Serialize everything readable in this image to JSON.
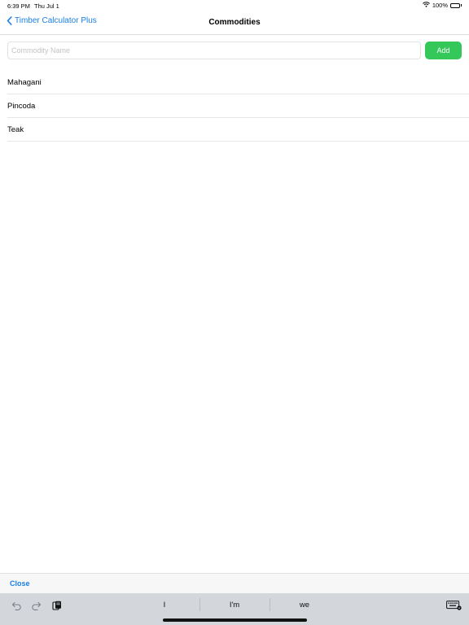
{
  "status_bar": {
    "time": "6:39 PM",
    "date": "Thu Jul 1",
    "battery": "100%"
  },
  "nav": {
    "back_label": "Timber Calculator Plus",
    "title": "Commodities"
  },
  "form": {
    "input_placeholder": "Commodity Name",
    "input_value": "",
    "add_label": "Add"
  },
  "commodities": [
    "Mahagani",
    "Pincoda",
    "Teak"
  ],
  "accessory": {
    "close_label": "Close"
  },
  "keyboard": {
    "suggestions": [
      "I",
      "I'm",
      "we"
    ],
    "tool_icons": [
      "undo-icon",
      "redo-icon",
      "paste-icon",
      "keyboard-dismiss-icon"
    ]
  },
  "colors": {
    "accent_blue": "#1a7ee6",
    "add_green": "#34c759",
    "keyboard_gray": "#d3d6db"
  }
}
